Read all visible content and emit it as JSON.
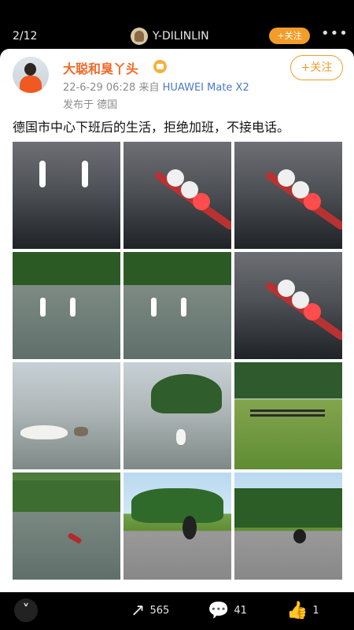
{
  "top_bar": {
    "counter": "2/12",
    "username": "Y-DILINLIN",
    "follow": "+关注",
    "more": "•••"
  },
  "post": {
    "author": "大聪和臭丫头",
    "follow": "+关注",
    "datetime": "22-6-29 06:28",
    "source_prefix": "来自",
    "device": "HUAWEI Mate X2",
    "location": "发布于 德国",
    "text": "德国市中心下班后的生活，拒绝加班，不接电话。"
  },
  "bottom_bar": {
    "collapse": "˅",
    "repost_count": "565",
    "comment_count": "41",
    "like_count": "1"
  },
  "icons": {
    "verified_badge": "crown-badge-icon",
    "repost": "share-icon",
    "comment": "comment-icon",
    "like": "thumb-up-icon"
  },
  "colors": {
    "accent": "#f29d2a",
    "author": "#f06a27",
    "device": "#4a79c9"
  }
}
